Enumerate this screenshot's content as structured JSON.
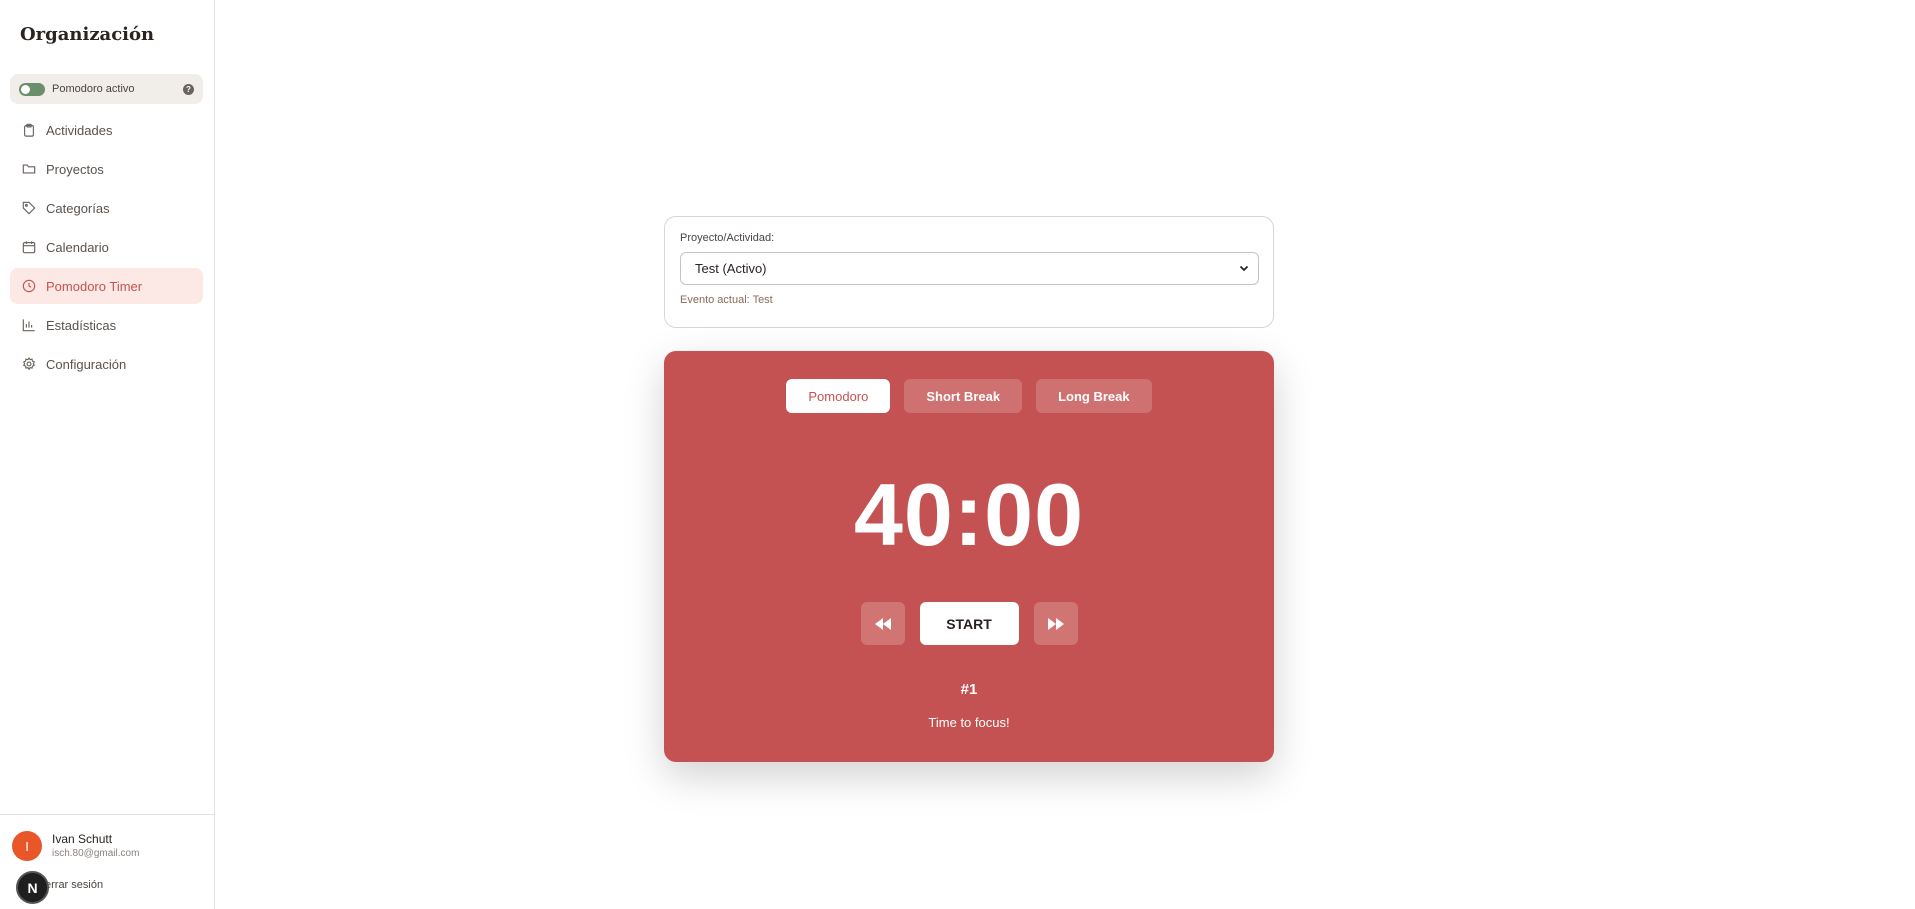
{
  "sidebar": {
    "brand": "Organización",
    "pomodoro_toggle": {
      "label": "Pomodoro activo",
      "enabled": true,
      "help": "?"
    },
    "items": [
      {
        "label": "Actividades",
        "icon": "clipboard-icon",
        "active": false
      },
      {
        "label": "Proyectos",
        "icon": "folder-icon",
        "active": false
      },
      {
        "label": "Categorías",
        "icon": "tag-icon",
        "active": false
      },
      {
        "label": "Calendario",
        "icon": "calendar-icon",
        "active": false
      },
      {
        "label": "Pomodoro Timer",
        "icon": "clock-icon",
        "active": true
      },
      {
        "label": "Estadísticas",
        "icon": "bar-chart-icon",
        "active": false
      },
      {
        "label": "Configuración",
        "icon": "gear-icon",
        "active": false
      }
    ],
    "user": {
      "initial": "I",
      "name": "Ivan Schutt",
      "email": "isch.80@gmail.com",
      "logout": "errar sesión"
    },
    "next_badge": "N"
  },
  "project": {
    "label": "Proyecto/Actividad:",
    "selected": "Test (Activo)",
    "current_event": "Evento actual: Test"
  },
  "timer": {
    "tabs": [
      "Pomodoro",
      "Short Break",
      "Long Break"
    ],
    "active_tab": "Pomodoro",
    "time": "40:00",
    "start_label": "START",
    "round": "#1",
    "message": "Time to focus!"
  },
  "colors": {
    "timer_bg": "#c55252",
    "accent_active_nav": "#c5524e",
    "toggle_on": "#6b8e6b",
    "avatar": "#e8562a"
  }
}
